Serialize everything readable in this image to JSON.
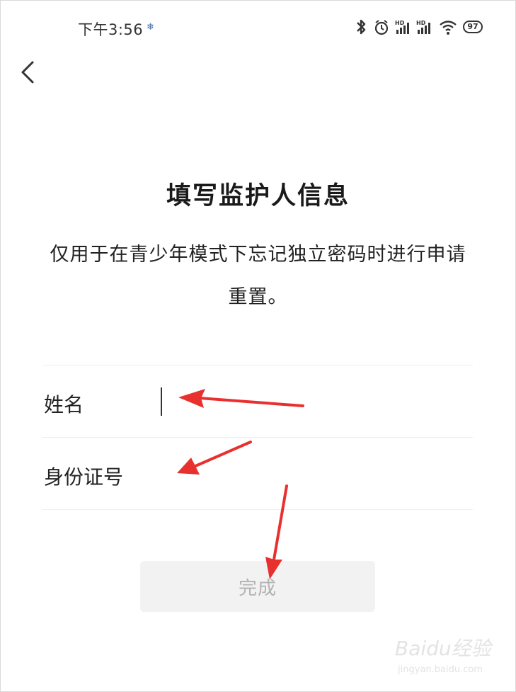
{
  "status_bar": {
    "time": "下午3:56",
    "battery": "97",
    "icons": [
      "bluetooth-icon",
      "alarm-icon",
      "signal-hd-icon",
      "signal-hd-icon",
      "wifi-icon",
      "battery-icon"
    ]
  },
  "header": {
    "back_icon": "chevron-left-icon"
  },
  "page": {
    "title": "填写监护人信息",
    "subtitle": "仅用于在青少年模式下忘记独立密码时进行申请重置。"
  },
  "form": {
    "name_label": "姓名",
    "name_value": "",
    "id_label": "身份证号",
    "id_value": ""
  },
  "actions": {
    "done_label": "完成",
    "done_enabled": false
  },
  "annotation": {
    "arrow_color": "#e8312f"
  },
  "watermark": {
    "brand": "Baidu经验",
    "url": "jingyan.baidu.com"
  }
}
